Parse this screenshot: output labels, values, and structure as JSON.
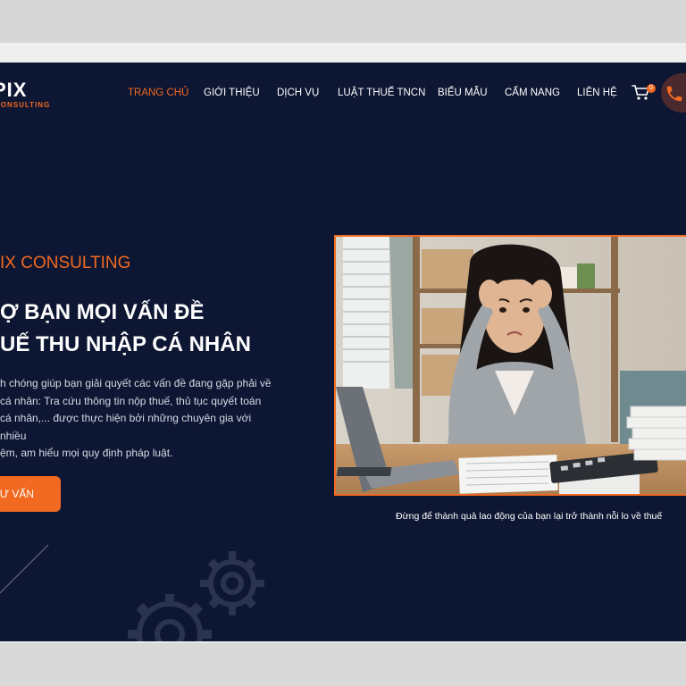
{
  "brand": {
    "logo_text": "PIX",
    "logo_sub": "CONSULTING",
    "accent": "#f26a21",
    "background": "#0d1632"
  },
  "nav": {
    "items": [
      {
        "label": "TRANG CHỦ",
        "active": true
      },
      {
        "label": "GIỚI THIỆU"
      },
      {
        "label": "DỊCH VỤ"
      },
      {
        "label": "LUẬT THUẾ TNCN"
      },
      {
        "label": "BIỂU MẪU"
      },
      {
        "label": "CẨM NANG"
      },
      {
        "label": "LIÊN HỆ"
      }
    ],
    "cart_icon": "cart-icon",
    "cart_count": "0",
    "phone_icon": "phone-icon"
  },
  "hero": {
    "brand_line": "IX CONSULTING",
    "headline_1": "Ợ BẠN MỌI VẤN ĐỀ",
    "headline_2": "UẾ THU NHẬP CÁ NHÂN",
    "desc_1": "h chóng giúp bạn giải quyết các vấn đề đang gặp phải về",
    "desc_2": "cá nhân: Tra cứu thông tin nộp thuế, thủ tục quyết toán",
    "desc_3": "cá nhân,... được thực hiện bởi những chuyên gia với nhiều",
    "desc_4": "ệm, am hiểu mọi quy định pháp luật.",
    "cta_label": "TƯ VẤN",
    "caption": "Đừng để thành quả lao động của bạn lại trở thành nỗi lo về thuế"
  }
}
